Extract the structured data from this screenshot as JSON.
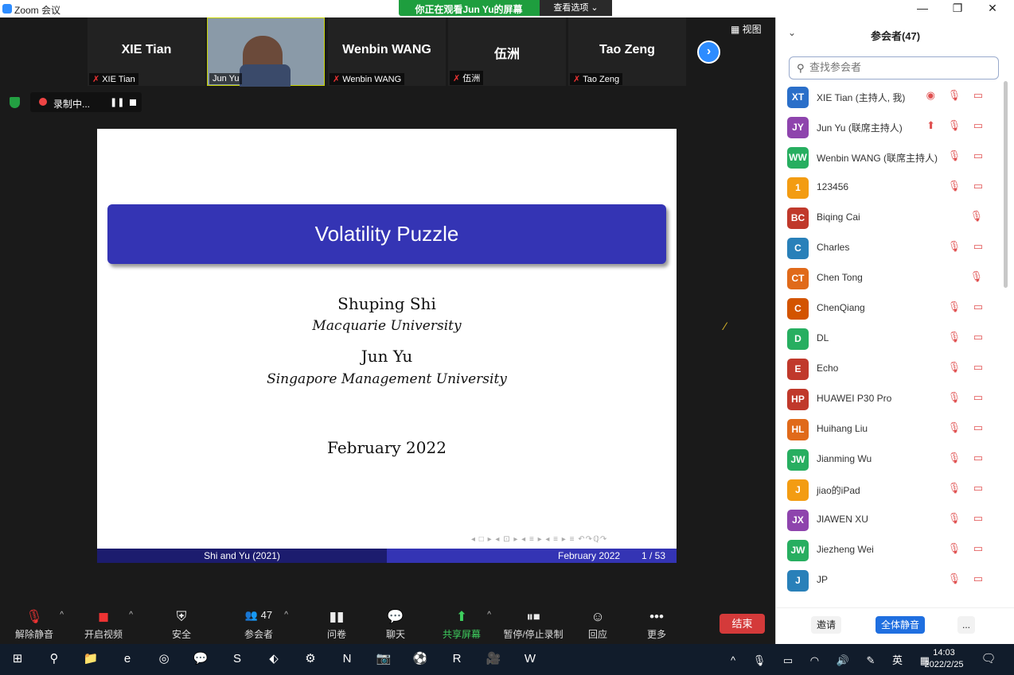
{
  "window": {
    "title": "Zoom 会议",
    "banner": "你正在观看Jun Yu的屏幕",
    "view_options": "查看选项 ⌄",
    "minimize": "—",
    "restore": "❐",
    "close": "✕"
  },
  "thumbs": [
    {
      "name": "XIE Tian",
      "tag": "XIE Tian"
    },
    {
      "name": "",
      "tag": "Jun Yu"
    },
    {
      "name": "Wenbin WANG",
      "tag": "Wenbin WANG"
    },
    {
      "name": "伍洲",
      "tag": "伍洲"
    },
    {
      "name": "Tao Zeng",
      "tag": "Tao Zeng"
    }
  ],
  "view_btn": "▦ 视图",
  "recording": {
    "label": "录制中...",
    "pause": "❚❚"
  },
  "slide": {
    "title": "Volatility Puzzle",
    "author1": "Shuping Shi",
    "aff1": "Macquarie University",
    "author2": "Jun Yu",
    "aff2": "Singapore Management University",
    "date": "February 2022",
    "footer_left": "Shi and Yu (2021)",
    "footer_date": "February 2022",
    "footer_page": "1 / 53",
    "nav_symbols": "◂ □ ▸ ◂ ⊡ ▸ ◂ ≡ ▸ ◂ ≡ ▸  ≡  ↶↷ℚ↷"
  },
  "toolbar": [
    {
      "icon": "🎙",
      "label": "解除静音",
      "caret": "^"
    },
    {
      "icon": "◼",
      "label": "开启视频",
      "caret": "^"
    },
    {
      "icon": "⛨",
      "label": "安全"
    },
    {
      "icon": "👥 47",
      "label": "参会者",
      "caret": "^"
    },
    {
      "icon": "▮▮",
      "label": "问卷"
    },
    {
      "icon": "💬",
      "label": "聊天"
    },
    {
      "icon": "⬆",
      "label": "共享屏幕",
      "caret": "^"
    },
    {
      "icon": "⏸⏹",
      "label": "暂停/停止录制"
    },
    {
      "icon": "☺",
      "label": "回应"
    },
    {
      "icon": "•••",
      "label": "更多"
    }
  ],
  "end_label": "结束",
  "panel": {
    "title": "参会者(47)",
    "search_placeholder": "查找参会者",
    "invite": "邀请",
    "mute_all": "全体静音",
    "more": "..."
  },
  "participants": [
    {
      "init": "XT",
      "color": "#2a6fc9",
      "name": "XIE Tian (主持人, 我)",
      "icons": "◉ 🎙 ▭"
    },
    {
      "init": "JY",
      "color": "#8e44ad",
      "name": "Jun Yu (联席主持人)",
      "icons": "⬆ 🎙 ▭"
    },
    {
      "init": "WW",
      "color": "#27ae60",
      "name": "Wenbin WANG (联席主持人)",
      "icons": "🎙 ▭"
    },
    {
      "init": "1",
      "color": "#f39c12",
      "name": "123456",
      "icons": "🎙 ▭"
    },
    {
      "init": "BC",
      "color": "#c0392b",
      "name": "Biqing Cai",
      "icons": "🎙"
    },
    {
      "init": "C",
      "color": "#2980b9",
      "name": "Charles",
      "icons": "🎙 ▭"
    },
    {
      "init": "CT",
      "color": "#e06a1a",
      "name": "Chen Tong",
      "icons": "🎙"
    },
    {
      "init": "C",
      "color": "#d35400",
      "name": "ChenQiang",
      "icons": "🎙 ▭"
    },
    {
      "init": "D",
      "color": "#27ae60",
      "name": "DL",
      "icons": "🎙 ▭"
    },
    {
      "init": "E",
      "color": "#c0392b",
      "name": "Echo",
      "icons": "🎙 ▭"
    },
    {
      "init": "HP",
      "color": "#c0392b",
      "name": "HUAWEI P30 Pro",
      "icons": "🎙 ▭"
    },
    {
      "init": "HL",
      "color": "#e06a1a",
      "name": "Huihang Liu",
      "icons": "🎙 ▭"
    },
    {
      "init": "JW",
      "color": "#27ae60",
      "name": "Jianming Wu",
      "icons": "🎙 ▭"
    },
    {
      "init": "J",
      "color": "#f39c12",
      "name": "jiao的iPad",
      "icons": "🎙 ▭"
    },
    {
      "init": "JX",
      "color": "#8e44ad",
      "name": "JIAWEN XU",
      "icons": "🎙 ▭"
    },
    {
      "init": "JW",
      "color": "#27ae60",
      "name": "Jiezheng Wei",
      "icons": "🎙 ▭"
    },
    {
      "init": "J",
      "color": "#2980b9",
      "name": "JP",
      "icons": "🎙 ▭"
    }
  ],
  "taskbar": {
    "icons": [
      "⊞",
      "⚲",
      "📁",
      "e",
      "◎",
      "💬",
      "S",
      "⬖",
      "⚙",
      "N",
      "📷",
      "⚽",
      "R",
      "🎥",
      "W"
    ],
    "tray": "^ 🎙 ▭ ◠ 🔊 ✎ 英 ▦",
    "time": "14:03",
    "date": "2022/2/25",
    "notif": "🗨"
  }
}
